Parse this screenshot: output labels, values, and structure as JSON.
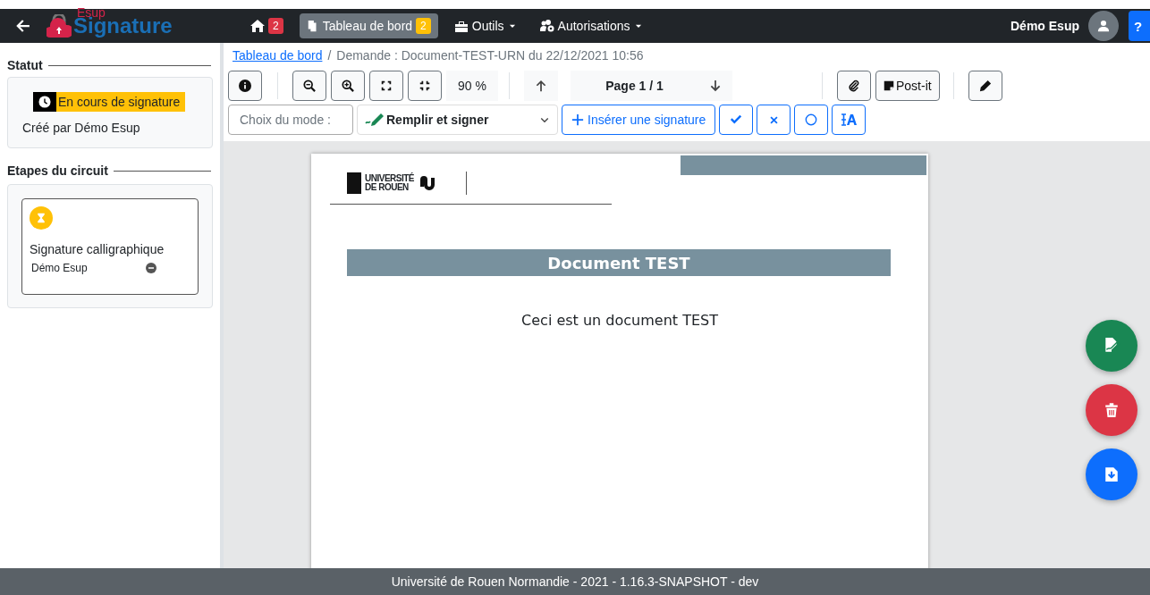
{
  "navbar": {
    "logo_small": "Esup",
    "logo": "Signature",
    "items": [
      {
        "kind": "home",
        "badge": "2",
        "color": "#dc3545",
        "selected": false
      },
      {
        "kind": "link",
        "label": "Tableau de bord",
        "badge": "2",
        "color": "#ffc107",
        "selected": true
      },
      {
        "kind": "toolbox",
        "label": "Outils",
        "selected": false
      },
      {
        "kind": "users",
        "label": "Autorisations",
        "selected": false
      }
    ],
    "user": "Démo Esup",
    "help": "?"
  },
  "sidebar": {
    "status_title": "Statut",
    "status": "En cours de signature",
    "created_by": "Créé par Démo Esup",
    "steps_title": "Etapes du circuit",
    "steps": [
      {
        "name": "Signature calligraphique",
        "signers": [
          {
            "name": "Démo Esup"
          }
        ]
      }
    ]
  },
  "breadcrumb": {
    "link": "Tableau de bord",
    "separator": "/",
    "current": "Demande : Document-TEST-URN du 22/12/2021 10:56"
  },
  "toolbar": {
    "zoom": "90 %",
    "page": "Page 1 / 1",
    "postit": "Post-it",
    "mode_label": "Choix du mode :",
    "mode": "Remplir et signer",
    "insert": "Insérer une signature"
  },
  "document": {
    "logo_line1": "UNIVERSITÉ",
    "logo_line2": "DE ROUEN",
    "heading": "Document TEST",
    "body": "Ceci est un document TEST"
  },
  "footer": "Université de Rouen Normandie - 2021 - 1.16.3-SNAPSHOT - dev"
}
